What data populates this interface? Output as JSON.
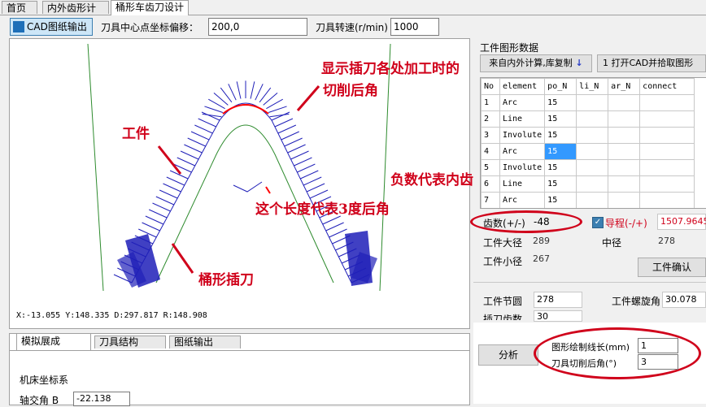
{
  "tabs": [
    {
      "label": "首页"
    },
    {
      "label": "内外齿形计算"
    },
    {
      "label": "桶形车齿刀设计"
    }
  ],
  "toolbar": {
    "cad_button": "CAD图纸输出",
    "offset_label": "刀具中心点坐标偏移：",
    "offset_value": "200,0",
    "speed_label": "刀具转速(r/min)",
    "speed_value": "1000"
  },
  "canvas": {
    "status": "X:-13.055  Y:148.335  D:297.817  R:148.908"
  },
  "bottom_tabs": [
    {
      "label": "模拟展成"
    },
    {
      "label": "刀具结构"
    },
    {
      "label": "图纸输出"
    }
  ],
  "bottom_panel": {
    "section": "机床坐标系",
    "axis_label": "轴交角 B",
    "axis_value": "-22.138"
  },
  "right": {
    "group_title": "工件图形数据",
    "copy_button": "来自内外计算,库复制",
    "cad_pick_button": "1 打开CAD并拾取图形",
    "columns": [
      "No",
      "element",
      "po_N",
      "li_N",
      "ar_N",
      "connect"
    ],
    "rows": [
      {
        "no": "1",
        "element": "Arc",
        "po": "15"
      },
      {
        "no": "2",
        "element": "Line",
        "po": "15"
      },
      {
        "no": "3",
        "element": "Involute",
        "po": "15"
      },
      {
        "no": "4",
        "element": "Arc",
        "po": "15"
      },
      {
        "no": "5",
        "element": "Involute",
        "po": "15"
      },
      {
        "no": "6",
        "element": "Line",
        "po": "15"
      },
      {
        "no": "7",
        "element": "Arc",
        "po": "15"
      }
    ],
    "teeth_label": "齿数(+/-)",
    "teeth_value": "-48",
    "lead_label": "导程(-/+)",
    "lead_value": "1507.9645",
    "big_dia_label": "工件大径",
    "big_dia_value": "289",
    "mid_dia_label": "中径",
    "mid_dia_value": "278",
    "small_dia_label": "工件小径",
    "small_dia_value": "267",
    "confirm_button": "工件确认",
    "pitch_label": "工件节圆",
    "pitch_value": "278",
    "helix_label": "工件螺旋角",
    "helix_value": "30.078",
    "insert_label": "插刀齿数",
    "insert_value": "30",
    "analyze_button": "分析",
    "line_len_label": "图形绘制线长(mm)",
    "line_len_value": "1",
    "relief_label": "刀具切削后角(°)",
    "relief_value": "3"
  },
  "annotations": {
    "show_relief": "显示插刀各处加工时的",
    "show_relief2": "切削后角",
    "workpiece": "工件",
    "length_3deg": "这个长度代表3度后角",
    "negative": "负数代表内齿",
    "barrel_cutter": "桶形插刀"
  },
  "colors": {
    "annot": "#d0021b",
    "profile": "#ff0000",
    "guide": "#2e8b2e",
    "hatch": "#1f1fb8"
  }
}
